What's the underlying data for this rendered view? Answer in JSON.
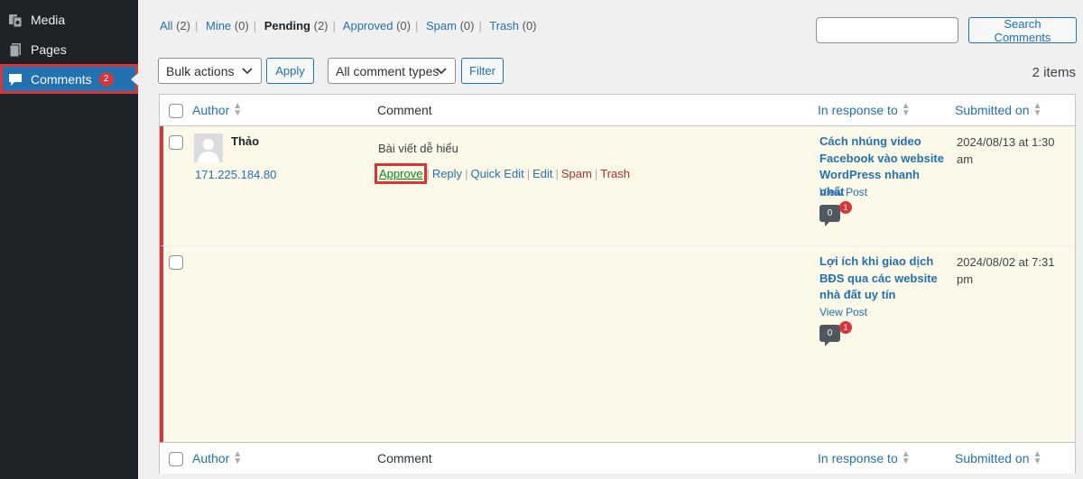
{
  "sidebar": {
    "items": [
      {
        "label": "Media",
        "icon": "media-icon"
      },
      {
        "label": "Pages",
        "icon": "pages-icon"
      },
      {
        "label": "Comments",
        "icon": "comments-icon",
        "badge": "2"
      }
    ]
  },
  "filters": {
    "all": {
      "label": "All",
      "count": "(2)"
    },
    "mine": {
      "label": "Mine",
      "count": "(0)"
    },
    "pending": {
      "label": "Pending",
      "count": "(2)"
    },
    "approved": {
      "label": "Approved",
      "count": "(0)"
    },
    "spam": {
      "label": "Spam",
      "count": "(0)"
    },
    "trash": {
      "label": "Trash",
      "count": "(0)"
    }
  },
  "search": {
    "value": "",
    "button": "Search Comments"
  },
  "bulk": {
    "selected": "Bulk actions",
    "apply": "Apply"
  },
  "type_filter": {
    "selected": "All comment types",
    "button": "Filter"
  },
  "items_count": "2 items",
  "columns": {
    "author": "Author",
    "comment": "Comment",
    "response": "In response to",
    "submitted": "Submitted on"
  },
  "rows": [
    {
      "author": "Thảo",
      "ip": "171.225.184.80",
      "comment": "Bài viết dễ hiểu",
      "actions": {
        "approve": "Approve",
        "reply": "Reply",
        "quick_edit": "Quick Edit",
        "edit": "Edit",
        "spam": "Spam",
        "trash": "Trash"
      },
      "post_title": "Cách nhúng video Facebook vào website WordPress nhanh nhất",
      "view_post": "View Post",
      "approved_count": "0",
      "pending_count": "1",
      "date": "2024/08/13 at 1:30 am"
    },
    {
      "author": "",
      "ip": "",
      "comment": "",
      "post_title": "Lợi ích khi giao dịch BĐS qua các website nhà đất uy tín",
      "view_post": "View Post",
      "approved_count": "0",
      "pending_count": "1",
      "date": "2024/08/02 at 7:31 pm"
    }
  ],
  "colors": {
    "sidebar_bg": "#1d2327",
    "accent": "#2271b1",
    "pending_row": "#fcf9e8",
    "highlight_red": "#d63638",
    "approve_green": "#008a20"
  }
}
